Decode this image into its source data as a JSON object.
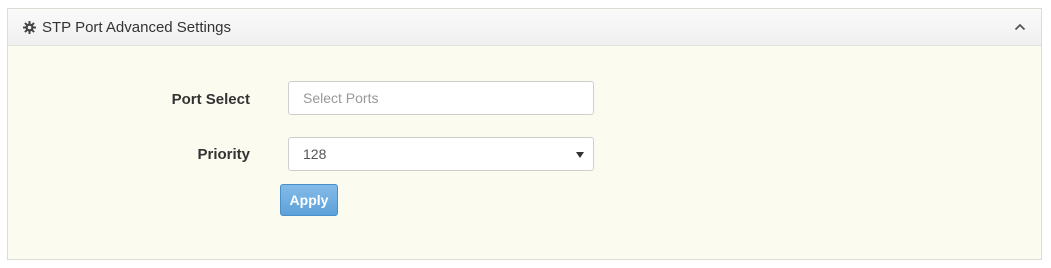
{
  "panel": {
    "title": "STP Port Advanced Settings",
    "header_icon": "gear-icon",
    "collapse_icon": "chevron-up-icon"
  },
  "form": {
    "port_select": {
      "label": "Port Select",
      "placeholder": "Select Ports",
      "value": ""
    },
    "priority": {
      "label": "Priority",
      "value": "128"
    },
    "apply_label": "Apply"
  },
  "colors": {
    "panel_background": "#fcfbef",
    "apply_button": "#5da1da"
  }
}
